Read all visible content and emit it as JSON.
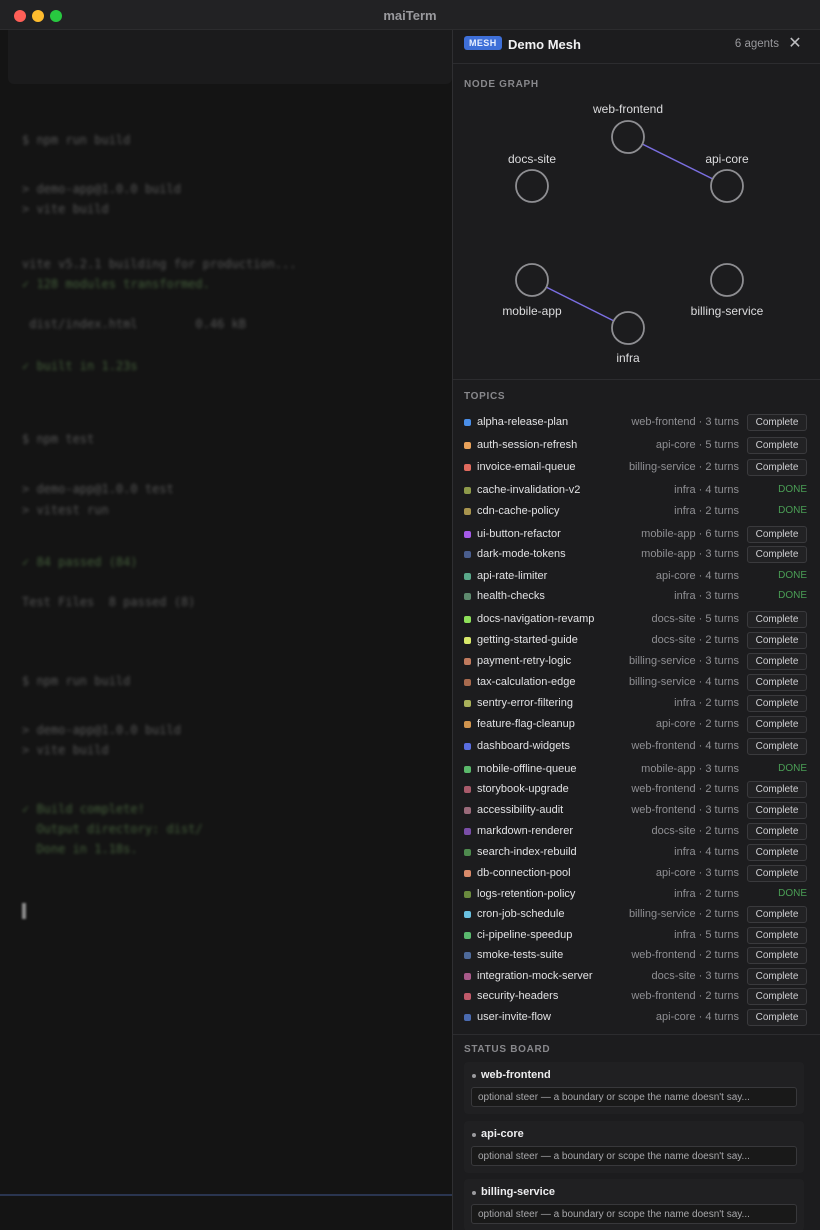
{
  "window": {
    "title": "maiTerm"
  },
  "terminal": {
    "lines": [
      "$ npm run build",
      "> demo-app@1.0.0 build",
      "> vite build",
      "vite v5.2.1 building for production...",
      "✓ 128 modules transformed.",
      " dist/index.html        0.46 kB",
      "✓ built in 1.23s",
      "$ npm test",
      "> demo-app@1.0.0 test",
      "> vitest run",
      "✓ 84 passed (84)",
      "Test Files  8 passed (8)",
      "$ npm run build",
      "> demo-app@1.0.0 build",
      "> vite build",
      "✓ Build complete!",
      "  Output directory: dist/",
      "  Done in 1.18s."
    ]
  },
  "panel": {
    "badge": "MESH",
    "title": "Demo Mesh",
    "agents": "6 agents",
    "close_icon": "close-icon"
  },
  "graph": {
    "label": "NODE GRAPH",
    "nodes": [
      "web-frontend",
      "docs-site",
      "api-core",
      "mobile-app",
      "billing-service",
      "infra"
    ],
    "edges": [
      [
        "web-frontend",
        "api-core"
      ],
      [
        "mobile-app",
        "infra"
      ]
    ],
    "edge_color": "#7a6ee0"
  },
  "topics": {
    "label": "TOPICS",
    "items": [
      {
        "name": "alpha-release-plan",
        "owner": "web-frontend",
        "turns": "3 turns",
        "status": "Complete",
        "color": "#4a8ee8"
      },
      {
        "name": "auth-session-refresh",
        "owner": "api-core",
        "turns": "5 turns",
        "status": "Complete",
        "color": "#e8a15a"
      },
      {
        "name": "invoice-email-queue",
        "owner": "billing-service",
        "turns": "2 turns",
        "status": "Complete",
        "color": "#e06a5e"
      },
      {
        "name": "cache-invalidation-v2",
        "owner": "infra",
        "turns": "4 turns",
        "status": "DONE",
        "color": "#8e9a4a"
      },
      {
        "name": "cdn-cache-policy",
        "owner": "infra",
        "turns": "2 turns",
        "status": "DONE",
        "color": "#a8944e"
      },
      {
        "name": "ui-button-refactor",
        "owner": "mobile-app",
        "turns": "6 turns",
        "status": "Complete",
        "color": "#a55ae8"
      },
      {
        "name": "dark-mode-tokens",
        "owner": "mobile-app",
        "turns": "3 turns",
        "status": "Complete",
        "color": "#4a5e8e"
      },
      {
        "name": "api-rate-limiter",
        "owner": "api-core",
        "turns": "4 turns",
        "status": "DONE",
        "color": "#5aa88a"
      },
      {
        "name": "health-checks",
        "owner": "infra",
        "turns": "3 turns",
        "status": "DONE",
        "color": "#5e8a6e"
      },
      {
        "name": "docs-navigation-revamp",
        "owner": "docs-site",
        "turns": "5 turns",
        "status": "Complete",
        "color": "#8ee05a"
      },
      {
        "name": "getting-started-guide",
        "owner": "docs-site",
        "turns": "2 turns",
        "status": "Complete",
        "color": "#d8e86a"
      },
      {
        "name": "payment-retry-logic",
        "owner": "billing-service",
        "turns": "3 turns",
        "status": "Complete",
        "color": "#c07a5e"
      },
      {
        "name": "tax-calculation-edge",
        "owner": "billing-service",
        "turns": "4 turns",
        "status": "Complete",
        "color": "#a86a4e"
      },
      {
        "name": "sentry-error-filtering",
        "owner": "infra",
        "turns": "2 turns",
        "status": "Complete",
        "color": "#a8b05a"
      },
      {
        "name": "feature-flag-cleanup",
        "owner": "api-core",
        "turns": "2 turns",
        "status": "Complete",
        "color": "#d0944e"
      },
      {
        "name": "dashboard-widgets",
        "owner": "web-frontend",
        "turns": "4 turns",
        "status": "Complete",
        "color": "#5a6ee0"
      },
      {
        "name": "mobile-offline-queue",
        "owner": "mobile-app",
        "turns": "3 turns",
        "status": "DONE",
        "color": "#5ab86a"
      },
      {
        "name": "storybook-upgrade",
        "owner": "web-frontend",
        "turns": "2 turns",
        "status": "Complete",
        "color": "#a85a6a"
      },
      {
        "name": "accessibility-audit",
        "owner": "web-frontend",
        "turns": "3 turns",
        "status": "Complete",
        "color": "#9a6a7a"
      },
      {
        "name": "markdown-renderer",
        "owner": "docs-site",
        "turns": "2 turns",
        "status": "Complete",
        "color": "#7a4ea8"
      },
      {
        "name": "search-index-rebuild",
        "owner": "infra",
        "turns": "4 turns",
        "status": "Complete",
        "color": "#4e8a4e"
      },
      {
        "name": "db-connection-pool",
        "owner": "api-core",
        "turns": "3 turns",
        "status": "Complete",
        "color": "#d88a6a"
      },
      {
        "name": "logs-retention-policy",
        "owner": "infra",
        "turns": "2 turns",
        "status": "DONE",
        "color": "#6a8a3e"
      },
      {
        "name": "cron-job-schedule",
        "owner": "billing-service",
        "turns": "2 turns",
        "status": "Complete",
        "color": "#6ac0e0"
      },
      {
        "name": "ci-pipeline-speedup",
        "owner": "infra",
        "turns": "5 turns",
        "status": "Complete",
        "color": "#5ab86e"
      },
      {
        "name": "smoke-tests-suite",
        "owner": "web-frontend",
        "turns": "2 turns",
        "status": "Complete",
        "color": "#4e6a9a"
      },
      {
        "name": "integration-mock-server",
        "owner": "docs-site",
        "turns": "3 turns",
        "status": "Complete",
        "color": "#a85a8a"
      },
      {
        "name": "security-headers",
        "owner": "web-frontend",
        "turns": "2 turns",
        "status": "Complete",
        "color": "#c05a6a"
      },
      {
        "name": "user-invite-flow",
        "owner": "api-core",
        "turns": "4 turns",
        "status": "Complete",
        "color": "#4a6ab0"
      }
    ]
  },
  "status_board": {
    "label": "STATUS BOARD",
    "placeholder": "optional steer — a boundary or scope the name doesn't say...",
    "agents": [
      "web-frontend",
      "api-core",
      "billing-service"
    ]
  }
}
